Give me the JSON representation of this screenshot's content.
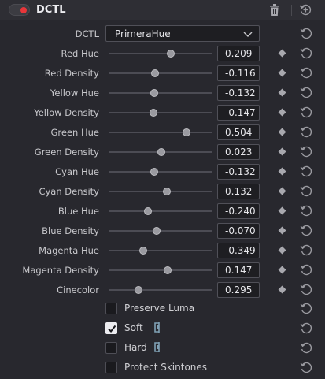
{
  "header": {
    "title": "DCTL",
    "enabled": true
  },
  "dctl": {
    "label": "DCTL",
    "selected": "PrimeraHue"
  },
  "sliders": [
    {
      "label": "Red Hue",
      "value": "0.209",
      "fill": 0.6
    },
    {
      "label": "Red Density",
      "value": "-0.116",
      "fill": 0.45
    },
    {
      "label": "Yellow Hue",
      "value": "-0.132",
      "fill": 0.44
    },
    {
      "label": "Yellow Density",
      "value": "-0.147",
      "fill": 0.43
    },
    {
      "label": "Green Hue",
      "value": "0.504",
      "fill": 0.75
    },
    {
      "label": "Green Density",
      "value": "0.023",
      "fill": 0.51
    },
    {
      "label": "Cyan Hue",
      "value": "-0.132",
      "fill": 0.44
    },
    {
      "label": "Cyan Density",
      "value": "0.132",
      "fill": 0.56
    },
    {
      "label": "Blue Hue",
      "value": "-0.240",
      "fill": 0.38
    },
    {
      "label": "Blue Density",
      "value": "-0.070",
      "fill": 0.46
    },
    {
      "label": "Magenta Hue",
      "value": "-0.349",
      "fill": 0.33
    },
    {
      "label": "Magenta Density",
      "value": "0.147",
      "fill": 0.57
    },
    {
      "label": "Cinecolor",
      "value": "0.295",
      "fill": 0.29
    }
  ],
  "checkboxes": [
    {
      "label": "Preserve Luma",
      "checked": false,
      "icon": ""
    },
    {
      "label": "Soft",
      "checked": true,
      "icon": "clamp-icon"
    },
    {
      "label": "Hard",
      "checked": false,
      "icon": "clamp-icon"
    },
    {
      "label": "Protect Skintones",
      "checked": false,
      "icon": ""
    }
  ],
  "colors": {
    "enabled_dot": "#e8363a",
    "background": "#28282e"
  }
}
